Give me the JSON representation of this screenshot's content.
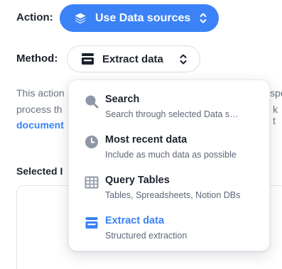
{
  "action": {
    "label": "Action:",
    "value": "Use Data sources",
    "icon": "layers-icon",
    "color": "#3b82f6"
  },
  "method": {
    "label": "Method:",
    "value": "Extract data",
    "icon": "tray-icon"
  },
  "description": {
    "line1": "This action",
    "line1_right": "spe",
    "line2": "process th",
    "line2_right": "k t",
    "link": "document"
  },
  "selected": {
    "label": "Selected I"
  },
  "menu": {
    "items": [
      {
        "title": "Search",
        "subtitle": "Search through selected Data s…",
        "icon": "magnifier-icon",
        "selected": false
      },
      {
        "title": "Most recent data",
        "subtitle": "Include as much data as possible",
        "icon": "clock-icon",
        "selected": false
      },
      {
        "title": "Query Tables",
        "subtitle": "Tables, Spreadsheets, Notion DBs",
        "icon": "table-icon",
        "selected": false
      },
      {
        "title": "Extract data",
        "subtitle": "Structured extraction",
        "icon": "tray-icon",
        "selected": true
      }
    ]
  }
}
